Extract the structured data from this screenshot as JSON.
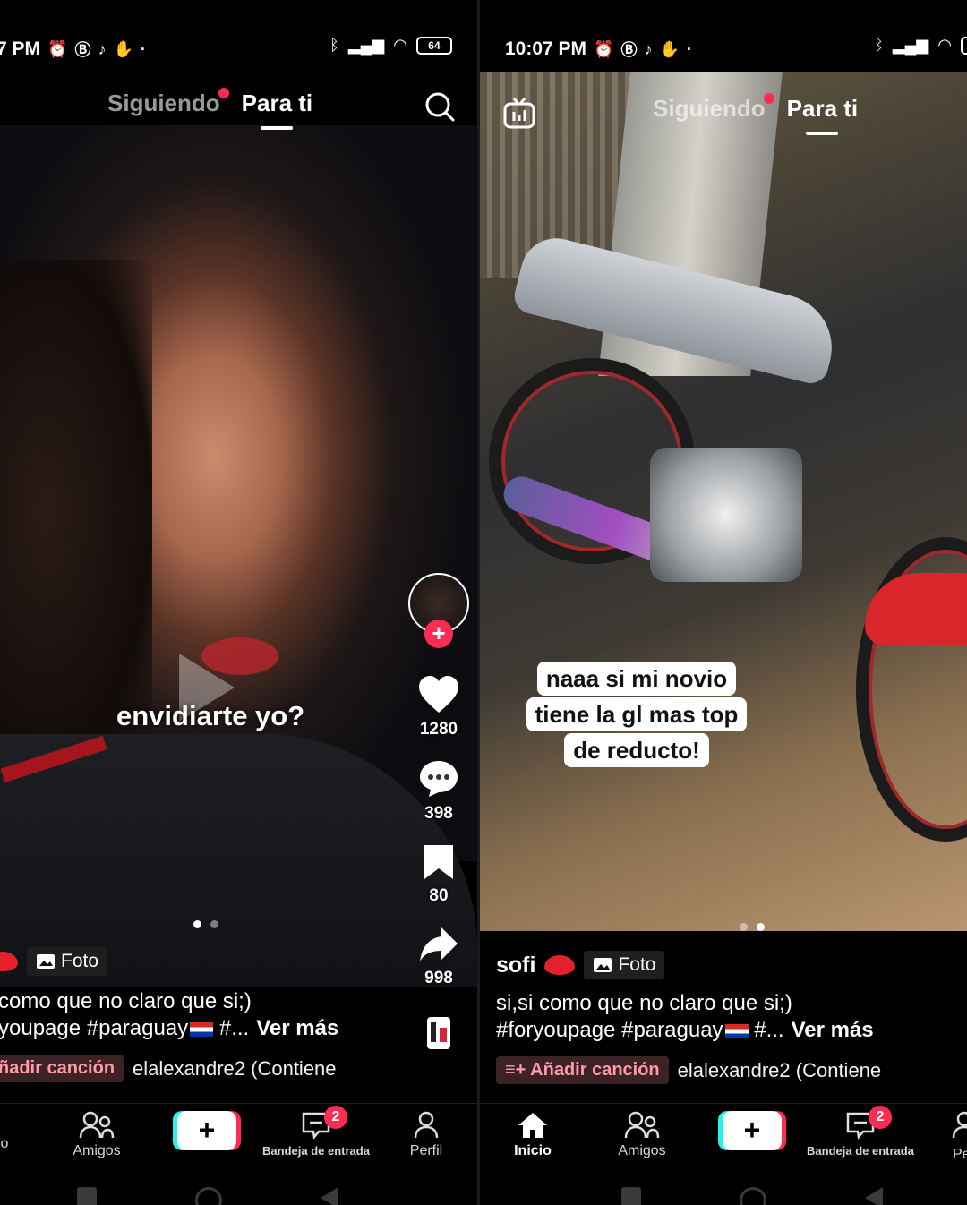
{
  "left": {
    "status": {
      "time": "7 PM",
      "battery": "64"
    },
    "tabs": {
      "following": "Siguiendo",
      "for_you": "Para ti"
    },
    "overlay_text": "envidiarte yo?",
    "rail": {
      "likes": "1280",
      "comments": "398",
      "saves": "80",
      "shares": "998"
    },
    "photo_tag": "Foto",
    "caption_line1": "como que no claro que si;)",
    "caption_line2": "youpage #paraguay",
    "caption_more": "#...",
    "ver_mas": "Ver más",
    "add_song": "ñadir canción",
    "music": "elalexandre2 (Contiene",
    "nav": {
      "friends": "Amigos",
      "inbox": "Bandeja de entrada",
      "profile": "Perfil",
      "home_partial": "o",
      "inbox_badge": "2"
    }
  },
  "right": {
    "status": {
      "time": "10:07 PM"
    },
    "tabs": {
      "following": "Siguiendo",
      "for_you": "Para ti"
    },
    "sticker_lines": [
      "naaa si mi novio",
      "tiene la gl mas top",
      "de reducto!"
    ],
    "author": "sofi",
    "photo_tag": "Foto",
    "caption_line1": "si,si como que no claro que si;)",
    "caption_line2": "#foryoupage #paraguay",
    "caption_more": "#...",
    "ver_mas": "Ver más",
    "add_song": "Añadir canción",
    "music": "elalexandre2 (Contiene",
    "nav": {
      "home": "Inicio",
      "friends": "Amigos",
      "inbox": "Bandeja de entrada",
      "profile_partial": "Pe",
      "inbox_badge": "2"
    }
  },
  "colors": {
    "accent_red": "#fe2c55",
    "accent_cyan": "#25f4ee",
    "background": "#000000"
  },
  "icons": [
    "search-icon",
    "live-icon",
    "heart-icon",
    "comment-icon",
    "bookmark-icon",
    "share-icon",
    "home-icon",
    "friends-icon",
    "inbox-icon",
    "profile-icon",
    "photo-icon",
    "lips-icon"
  ]
}
